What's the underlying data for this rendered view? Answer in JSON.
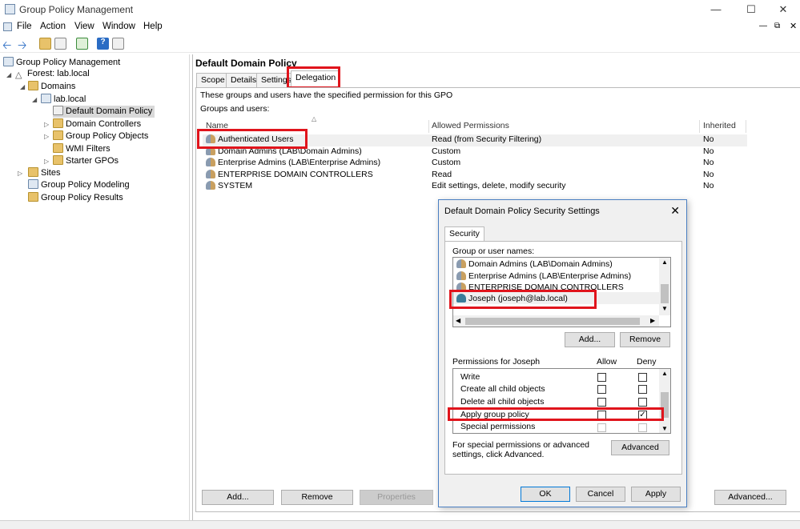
{
  "window": {
    "title": "Group Policy Management"
  },
  "menu": [
    "File",
    "Action",
    "View",
    "Window",
    "Help"
  ],
  "tree": {
    "root": "Group Policy Management",
    "forest": "Forest: lab.local",
    "domains": "Domains",
    "domain": "lab.local",
    "selected": "Default Domain Policy",
    "items": [
      "Domain Controllers",
      "Group Policy Objects",
      "WMI Filters",
      "Starter GPOs"
    ],
    "sites": "Sites",
    "modeling": "Group Policy Modeling",
    "results": "Group Policy Results"
  },
  "policy": {
    "title": "Default Domain Policy",
    "tabs": [
      "Scope",
      "Details",
      "Settings",
      "Delegation"
    ],
    "active_tab": "Delegation",
    "description": "These groups and users have the specified permission for this GPO",
    "groups_label": "Groups and users:",
    "columns": [
      "Name",
      "Allowed Permissions",
      "Inherited"
    ],
    "rows": [
      {
        "name": "Authenticated Users",
        "perm": "Read (from Security Filtering)",
        "inherited": "No"
      },
      {
        "name": "Domain Admins (LAB\\Domain Admins)",
        "perm": "Custom",
        "inherited": "No"
      },
      {
        "name": "Enterprise Admins (LAB\\Enterprise Admins)",
        "perm": "Custom",
        "inherited": "No"
      },
      {
        "name": "ENTERPRISE DOMAIN CONTROLLERS",
        "perm": "Read",
        "inherited": "No"
      },
      {
        "name": "SYSTEM",
        "perm": "Edit settings, delete, modify security",
        "inherited": "No"
      }
    ],
    "buttons": {
      "add": "Add...",
      "remove": "Remove",
      "properties": "Properties",
      "advanced": "Advanced..."
    }
  },
  "dialog": {
    "title": "Default Domain Policy Security Settings",
    "tab": "Security",
    "group_label": "Group or user names:",
    "users": [
      "Domain Admins (LAB\\Domain Admins)",
      "Enterprise Admins (LAB\\Enterprise Admins)",
      "ENTERPRISE DOMAIN CONTROLLERS",
      "Joseph (joseph@lab.local)"
    ],
    "add": "Add...",
    "remove": "Remove",
    "perm_label": "Permissions for Joseph",
    "allow": "Allow",
    "deny": "Deny",
    "perms": [
      {
        "name": "Write",
        "allow": false,
        "deny": false
      },
      {
        "name": "Create all child objects",
        "allow": false,
        "deny": false
      },
      {
        "name": "Delete all child objects",
        "allow": false,
        "deny": false
      },
      {
        "name": "Apply group policy",
        "allow": false,
        "deny": true
      },
      {
        "name": "Special permissions",
        "allow": false,
        "deny": false
      }
    ],
    "special_note": "For special permissions or advanced settings, click Advanced.",
    "advanced": "Advanced",
    "ok": "OK",
    "cancel": "Cancel",
    "apply": "Apply"
  },
  "colors": {
    "highlight": "#e0141c",
    "selected_bg": "#cce8ff",
    "accent": "#4a7fc2"
  }
}
